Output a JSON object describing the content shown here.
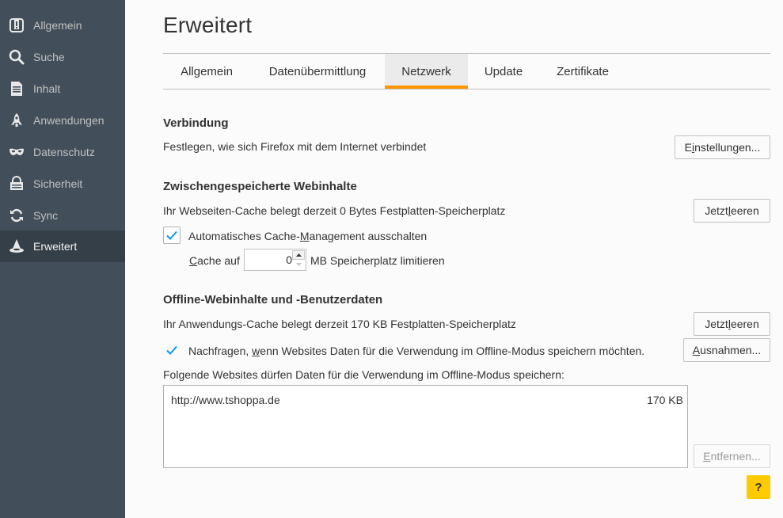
{
  "sidebar": {
    "items": [
      {
        "label": "Allgemein",
        "icon": "general-icon"
      },
      {
        "label": "Suche",
        "icon": "search-icon"
      },
      {
        "label": "Inhalt",
        "icon": "document-icon"
      },
      {
        "label": "Anwendungen",
        "icon": "rocket-icon"
      },
      {
        "label": "Datenschutz",
        "icon": "mask-icon"
      },
      {
        "label": "Sicherheit",
        "icon": "lock-icon"
      },
      {
        "label": "Sync",
        "icon": "sync-icon"
      },
      {
        "label": "Erweitert",
        "icon": "wizard-hat-icon",
        "active": true
      }
    ]
  },
  "page": {
    "title": "Erweitert"
  },
  "tabs": [
    {
      "label": "Allgemein"
    },
    {
      "label": "Datenübermittlung"
    },
    {
      "label": "Netzwerk",
      "active": true
    },
    {
      "label": "Update"
    },
    {
      "label": "Zertifikate"
    }
  ],
  "connection": {
    "heading": "Verbindung",
    "description": "Festlegen, wie sich Firefox mit dem Internet verbindet",
    "settings_button": {
      "before": "E",
      "accesskey": "i",
      "after": "nstellungen..."
    }
  },
  "cache": {
    "heading": "Zwischengespeicherte Webinhalte",
    "description": "Ihr Webseiten-Cache belegt derzeit 0 Bytes Festplatten-Speicherplatz",
    "clear_button": {
      "before": "Jetzt ",
      "accesskey": "l",
      "after": "eeren"
    },
    "override_checkbox": {
      "checked": true,
      "before": "Automatisches Cache-",
      "accesskey": "M",
      "after": "anagement ausschalten"
    },
    "limit": {
      "before": "",
      "accesskey": "C",
      "after": "ache auf",
      "value": "0",
      "suffix": "MB Speicherplatz limitieren"
    }
  },
  "offline": {
    "heading": "Offline-Webinhalte und -Benutzerdaten",
    "description": "Ihr Anwendungs-Cache belegt derzeit 170 KB Festplatten-Speicherplatz",
    "clear_button": {
      "before": "Jetzt ",
      "accesskey": "l",
      "after": "eeren"
    },
    "ask_checkbox": {
      "checked": true,
      "before": "Nachfragen, ",
      "accesskey": "w",
      "after": "enn Websites Daten für die Verwendung im Offline-Modus speichern möchten."
    },
    "exceptions_button": {
      "before": "",
      "accesskey": "A",
      "after": "usnahmen..."
    },
    "list_caption": "Folgende Websites dürfen Daten für die Verwendung im Offline-Modus speichern:",
    "sites": [
      {
        "url": "http://www.tshoppa.de",
        "size": "170 KB"
      }
    ],
    "remove_button": {
      "before": "",
      "accesskey": "E",
      "after": "ntfernen..."
    }
  },
  "help": {
    "label": "?"
  },
  "colors": {
    "sidebar": "#424f5a",
    "sidebar_active": "#343f48",
    "tab_accent": "#ff9500",
    "checkbox_check": "#0996f8",
    "help": "#ffcb00"
  }
}
